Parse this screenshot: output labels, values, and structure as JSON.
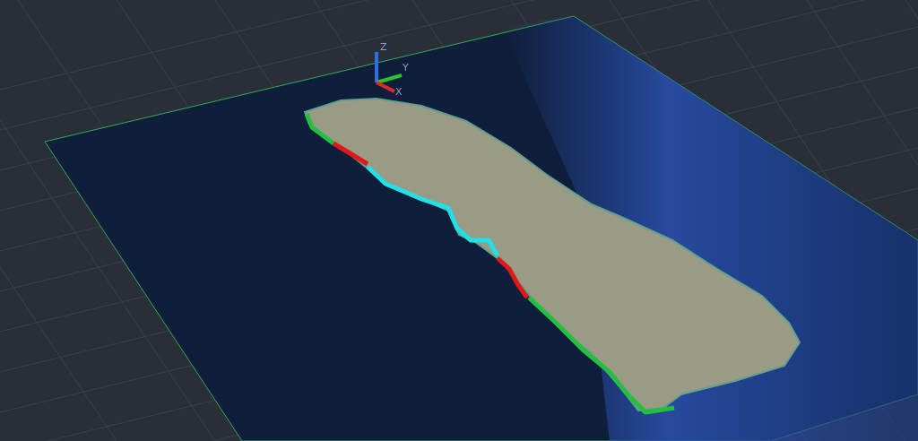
{
  "viewport": {
    "ucs_axes": [
      {
        "label": "Z",
        "color": "#2f6fe0"
      },
      {
        "label": "Y",
        "color": "#2fc02f"
      },
      {
        "label": "X",
        "color": "#e02828"
      }
    ],
    "shore_segments": [
      {
        "color": "#22c040"
      },
      {
        "color": "#e01818"
      },
      {
        "color": "#20e0e8"
      },
      {
        "color": "#e01818"
      },
      {
        "color": "#22c040"
      }
    ]
  }
}
